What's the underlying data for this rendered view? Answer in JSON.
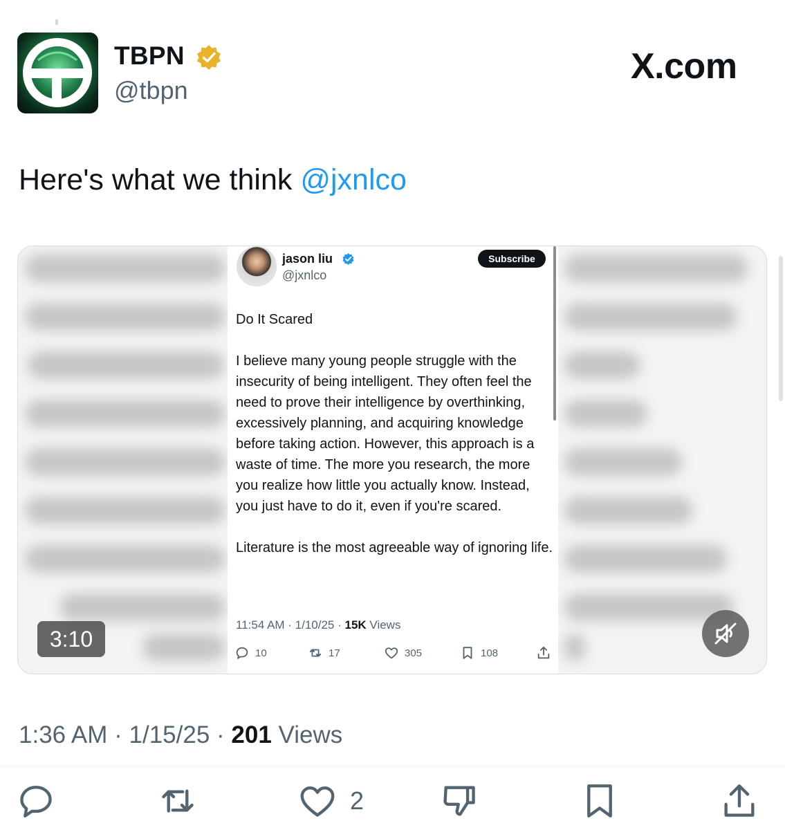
{
  "author": {
    "name": "TBPN",
    "handle": "@tbpn",
    "verified_color": "#e8b32a"
  },
  "source": {
    "label": "X.com"
  },
  "tweet": {
    "text": "Here's what we think ",
    "mention": "@jxnlco",
    "mention_color": "#1d9bf0"
  },
  "media": {
    "duration": "3:10",
    "mute_icon": "muted-speaker-icon",
    "embedded_post": {
      "author_name": "jason liu",
      "author_handle": "@jxnlco",
      "subscribe_label": "Subscribe",
      "title": "Do It Scared",
      "paragraph_1": "I believe many young people struggle with the insecurity of being intelligent. They often feel the need to prove their intelligence by overthinking, excessively planning, and acquiring knowledge before taking action. However, this approach is a waste of time. The more you research, the more you realize how little you actually know. Instead, you just have to do it, even if you're scared.",
      "paragraph_2": "Literature is the most agreeable way of ignoring life.",
      "timestamp": "11:54 AM · 1/10/25 · ",
      "views_count": "15K",
      "views_label": " Views",
      "replies": "10",
      "reposts": "17",
      "likes": "305",
      "bookmarks": "108"
    }
  },
  "meta": {
    "timestamp": "1:36 AM · 1/15/25 · ",
    "views_count": "201",
    "views_label": " Views"
  },
  "actions": {
    "likes": "2",
    "icons": [
      "reply-icon",
      "repost-icon",
      "like-icon",
      "dislike-icon",
      "bookmark-icon",
      "share-icon"
    ]
  }
}
